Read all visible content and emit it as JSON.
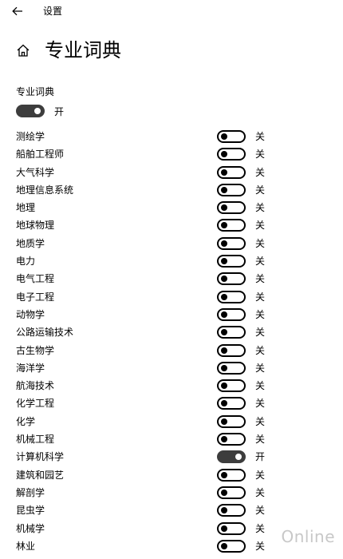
{
  "window": {
    "title": "设置"
  },
  "page": {
    "title": "专业词典"
  },
  "master": {
    "label": "专业词典",
    "state": "开",
    "on": true
  },
  "items": [
    {
      "label": "测绘学",
      "state": "关",
      "on": false
    },
    {
      "label": "船舶工程师",
      "state": "关",
      "on": false
    },
    {
      "label": "大气科学",
      "state": "关",
      "on": false
    },
    {
      "label": "地理信息系统",
      "state": "关",
      "on": false
    },
    {
      "label": "地理",
      "state": "关",
      "on": false
    },
    {
      "label": "地球物理",
      "state": "关",
      "on": false
    },
    {
      "label": "地质学",
      "state": "关",
      "on": false
    },
    {
      "label": "电力",
      "state": "关",
      "on": false
    },
    {
      "label": "电气工程",
      "state": "关",
      "on": false
    },
    {
      "label": "电子工程",
      "state": "关",
      "on": false
    },
    {
      "label": "动物学",
      "state": "关",
      "on": false
    },
    {
      "label": "公路运输技术",
      "state": "关",
      "on": false
    },
    {
      "label": "古生物学",
      "state": "关",
      "on": false
    },
    {
      "label": "海洋学",
      "state": "关",
      "on": false
    },
    {
      "label": "航海技术",
      "state": "关",
      "on": false
    },
    {
      "label": "化学工程",
      "state": "关",
      "on": false
    },
    {
      "label": "化学",
      "state": "关",
      "on": false
    },
    {
      "label": "机械工程",
      "state": "关",
      "on": false
    },
    {
      "label": "计算机科学",
      "state": "开",
      "on": true
    },
    {
      "label": "建筑和园艺",
      "state": "关",
      "on": false
    },
    {
      "label": "解剖学",
      "state": "关",
      "on": false
    },
    {
      "label": "昆虫学",
      "state": "关",
      "on": false
    },
    {
      "label": "机械学",
      "state": "关",
      "on": false
    },
    {
      "label": "林业",
      "state": "关",
      "on": false
    }
  ],
  "watermark": "Online",
  "colors": {
    "toggle_on": "#3d3d3d",
    "toggle_off_border": "#000000"
  },
  "icons": {
    "back": "arrow-left-icon",
    "home": "home-icon"
  }
}
